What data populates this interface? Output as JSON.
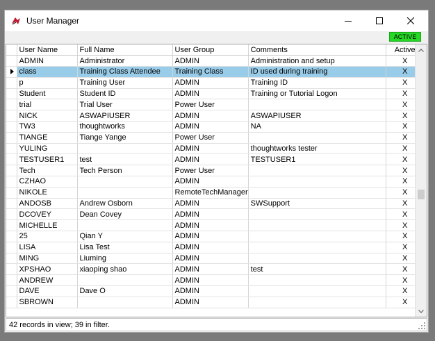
{
  "window": {
    "title": "User Manager",
    "status_badge": "ACTIVE",
    "accent_color": "#26d826",
    "selection_color": "#99cce8"
  },
  "table": {
    "columns": [
      "User Name",
      "Full Name",
      "User Group",
      "Comments",
      "Active"
    ],
    "selected_index": 1,
    "rows": [
      [
        "ADMIN",
        "Administrator",
        "ADMIN",
        "Administration and setup",
        "X"
      ],
      [
        "class",
        "Training Class Attendee",
        "Training Class",
        "ID used during training",
        "X"
      ],
      [
        "p",
        "Training User",
        "ADMIN",
        "Training ID",
        "X"
      ],
      [
        "Student",
        "Student ID",
        "ADMIN",
        "Training or Tutorial Logon",
        "X"
      ],
      [
        "trial",
        "Trial User",
        "Power User",
        "",
        "X"
      ],
      [
        "NICK",
        "ASWAPIUSER",
        "ADMIN",
        "ASWAPIUSER",
        "X"
      ],
      [
        "TW3",
        "thoughtworks",
        "ADMIN",
        "NA",
        "X"
      ],
      [
        "TIANGE",
        "Tiange Yange",
        "Power User",
        "",
        "X"
      ],
      [
        "YULING",
        "",
        "ADMIN",
        "thoughtworks tester",
        "X"
      ],
      [
        "TESTUSER1",
        "test",
        "ADMIN",
        "TESTUSER1",
        "X"
      ],
      [
        "Tech",
        "Tech Person",
        "Power User",
        "",
        "X"
      ],
      [
        "CZHAO",
        "",
        "ADMIN",
        "",
        "X"
      ],
      [
        "NIKOLE",
        "",
        "RemoteTechManager",
        "",
        "X"
      ],
      [
        "ANDOSB",
        "Andrew Osborn",
        "ADMIN",
        "SWSupport",
        "X"
      ],
      [
        "DCOVEY",
        "Dean Covey",
        "ADMIN",
        "",
        "X"
      ],
      [
        "MICHELLE",
        "",
        "ADMIN",
        "",
        "X"
      ],
      [
        "25",
        "Qian Y",
        "ADMIN",
        "",
        "X"
      ],
      [
        "LISA",
        "Lisa Test",
        "ADMIN",
        "",
        "X"
      ],
      [
        "MING",
        "Liuming",
        "ADMIN",
        "",
        "X"
      ],
      [
        "XPSHAO",
        "xiaoping shao",
        "ADMIN",
        "test",
        "X"
      ],
      [
        "ANDREW",
        "",
        "ADMIN",
        "",
        "X"
      ],
      [
        "DAVE",
        "Dave O",
        "ADMIN",
        "",
        "X"
      ],
      [
        "SBROWN",
        "",
        "ADMIN",
        "",
        "X"
      ]
    ]
  },
  "scrollbar": {
    "position_fraction": 0.5
  },
  "footer": {
    "status_text": "42 records in view; 39 in filter."
  },
  "icons": {
    "app": "app-logo-icon",
    "minimize": "minimize-icon",
    "maximize": "maximize-icon",
    "close": "close-icon",
    "row_indicator": "row-pointer-icon",
    "scroll_up": "chevron-up-icon",
    "scroll_down": "chevron-down-icon"
  }
}
